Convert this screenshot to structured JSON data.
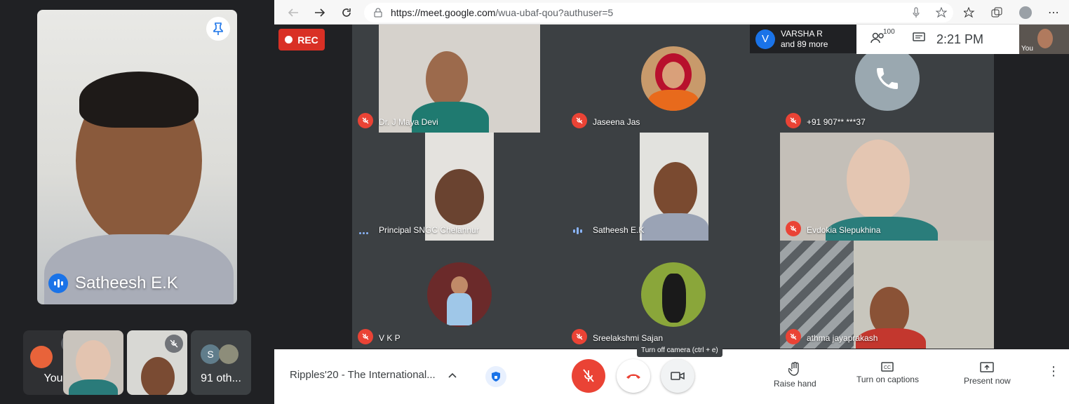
{
  "phone": {
    "pinned_name": "Satheesh E.K",
    "thumbnails": [
      {
        "label": "You"
      },
      {
        "label": ""
      },
      {
        "label": ""
      },
      {
        "initial": "S",
        "label": "91 oth..."
      }
    ]
  },
  "browser": {
    "url_host": "https://meet.google.com",
    "url_path": "/wua-ubaf-qou?authuser=5"
  },
  "meet": {
    "rec_label": "REC",
    "presenter_initial": "V",
    "presenter_name": "VARSHA R",
    "presenter_more": "and 89 more",
    "people_count": "100",
    "clock": "2:21 PM",
    "self_label": "You",
    "participants": [
      {
        "name": "Dr. J Maya Devi",
        "state": "muted"
      },
      {
        "name": "Jaseena Jas",
        "state": "muted"
      },
      {
        "name": "+91 907** ***37",
        "state": "muted"
      },
      {
        "name": "Principal SNGC Chelannur",
        "state": "talking-dots"
      },
      {
        "name": "Satheesh E.K",
        "state": "speaking"
      },
      {
        "name": "Evdokia Slepukhina",
        "state": "muted"
      },
      {
        "name": "V K P",
        "state": "muted"
      },
      {
        "name": "Sreelakshmi Sajan",
        "state": "muted"
      },
      {
        "name": "athma jayaprakash",
        "state": "muted"
      }
    ]
  },
  "bottom": {
    "meeting_title": "Ripples'20 - The International...",
    "tooltip": "Turn off camera (ctrl + e)",
    "raise_hand": "Raise hand",
    "captions": "Turn on captions",
    "present": "Present now"
  },
  "colors": {
    "accent": "#1a73e8",
    "danger": "#ea4335",
    "bg_dark": "#202124"
  }
}
